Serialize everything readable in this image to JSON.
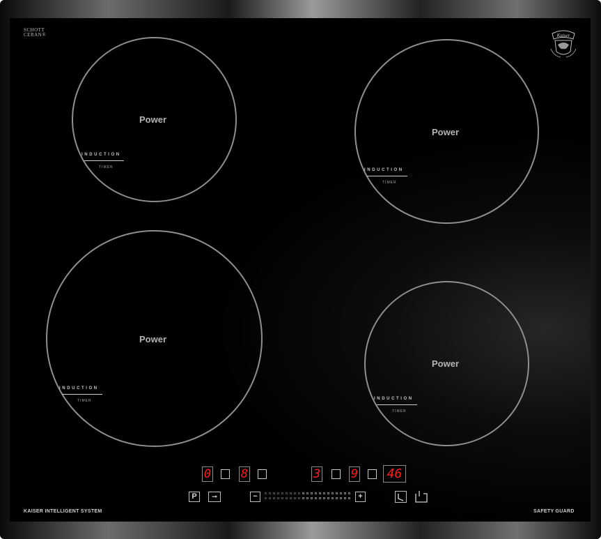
{
  "cooktop": {
    "zones": [
      {
        "power_label": "Power",
        "induction_label": "INDUCTION",
        "timer_label": "TIMER"
      },
      {
        "power_label": "Power",
        "induction_label": "INDUCTION",
        "timer_label": "TIMER"
      },
      {
        "power_label": "Power",
        "induction_label": "INDUCTION",
        "timer_label": "TIMER"
      },
      {
        "power_label": "Power",
        "induction_label": "INDUCTION",
        "timer_label": "TIMER"
      }
    ],
    "glass_brand": {
      "line1": "SCHOTT",
      "line2": "CERAN®"
    },
    "logo_text": "Kaiser",
    "footer_left": "KAISER INTELLIGENT SYSTEM",
    "footer_right": "SAFETY GUARD",
    "displays": {
      "zone1": "0",
      "zone2": "8",
      "zone3": "3",
      "zone4": "9",
      "timer": "46"
    },
    "buttons": {
      "pause": "P",
      "lock": "⊸",
      "minus": "−",
      "plus": "+",
      "clock_icon": "clock-icon",
      "power_icon": "power-icon"
    },
    "colors": {
      "display_red": "#ff1c1c",
      "glass": "#000000",
      "ring": "#8f8f8f"
    }
  }
}
